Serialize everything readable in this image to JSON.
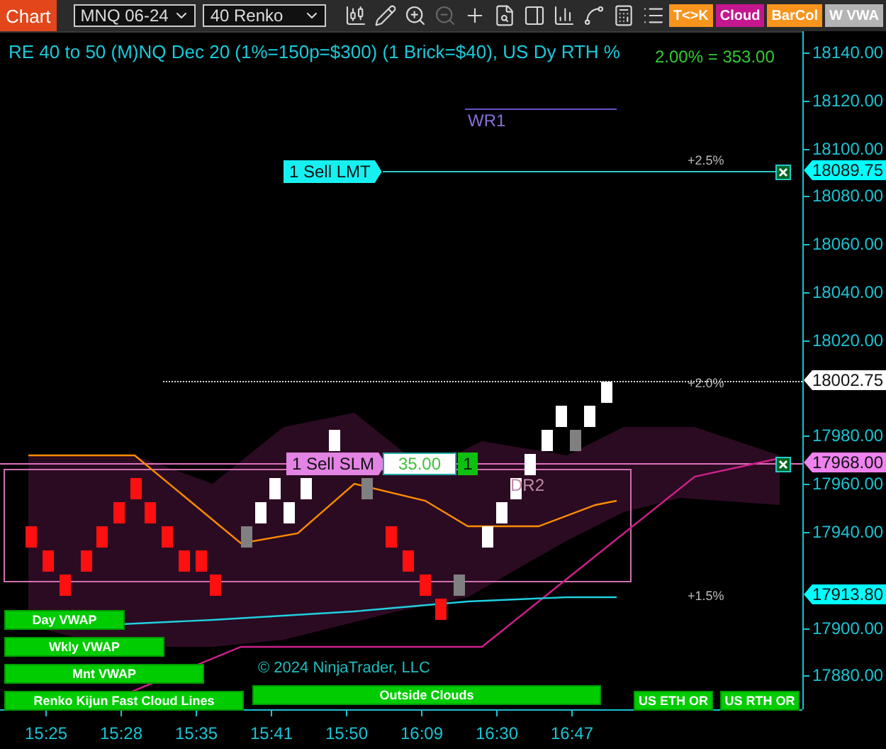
{
  "toolbar": {
    "tab": "Chart",
    "instrument": "MNQ 06-24",
    "period": "40 Renko",
    "tools": [
      {
        "disabled": false
      },
      {
        "disabled": false
      },
      {
        "disabled": false
      },
      {
        "disabled": true
      },
      {
        "disabled": false
      },
      {
        "disabled": false
      },
      {
        "disabled": false
      },
      {
        "disabled": false
      },
      {
        "disabled": false
      },
      {
        "disabled": false
      },
      {
        "disabled": false
      }
    ],
    "toggles": [
      {
        "label": "T<>K",
        "color": "#f7941d"
      },
      {
        "label": "Cloud",
        "color": "#c4168f"
      },
      {
        "label": "BarCol",
        "color": "#f7941d"
      },
      {
        "label": "W VWA",
        "color": "#b4b4b4"
      }
    ]
  },
  "chart": {
    "title": "RE 40 to 50 (M)NQ Dec 20 (1%=150p=$300) (1 Brick=$40), US Dy RTH %",
    "range_readout": "2.00% = 353.00",
    "level_labels": [
      {
        "text": "WR1",
        "kind": "pivot"
      },
      {
        "text": "+2.5%",
        "kind": "percent"
      },
      {
        "text": "+2.0%",
        "kind": "percent"
      },
      {
        "text": "DR2",
        "kind": "pivot"
      },
      {
        "text": "+1.5%",
        "kind": "percent"
      }
    ],
    "orders": [
      {
        "label": "1 Sell LMT",
        "kind": "limit"
      },
      {
        "label": "1 Sell SLM",
        "kind": "stop",
        "price": "35.00",
        "quantity": "1"
      }
    ],
    "indicator_buttons": [
      "Day VWAP",
      "Wkly VWAP",
      "Mnt VWAP",
      "Renko Kijun Fast Cloud Lines",
      "Outside Clouds",
      "US ETH OR",
      "US RTH OR"
    ],
    "copyright": "© 2024 NinjaTrader, LLC"
  },
  "price_axis": {
    "ticks": [
      "18140.00",
      "18120.00",
      "18100.00",
      "18080.00",
      "18060.00",
      "18040.00",
      "18020.00",
      "17980.00",
      "17960.00",
      "17940.00",
      "17900.00",
      "17880.00"
    ],
    "markers": [
      {
        "text": "18089.75",
        "color": "#00ffff"
      },
      {
        "text": "18002.75",
        "color": "#ffffff"
      },
      {
        "text": "17968.00",
        "color": "#ee82ee"
      },
      {
        "text": "17913.80",
        "color": "#00ffff"
      }
    ]
  },
  "time_axis": {
    "ticks": [
      "15:25",
      "15:28",
      "15:35",
      "15:41",
      "15:50",
      "16:09",
      "16:30",
      "16:47"
    ]
  }
}
